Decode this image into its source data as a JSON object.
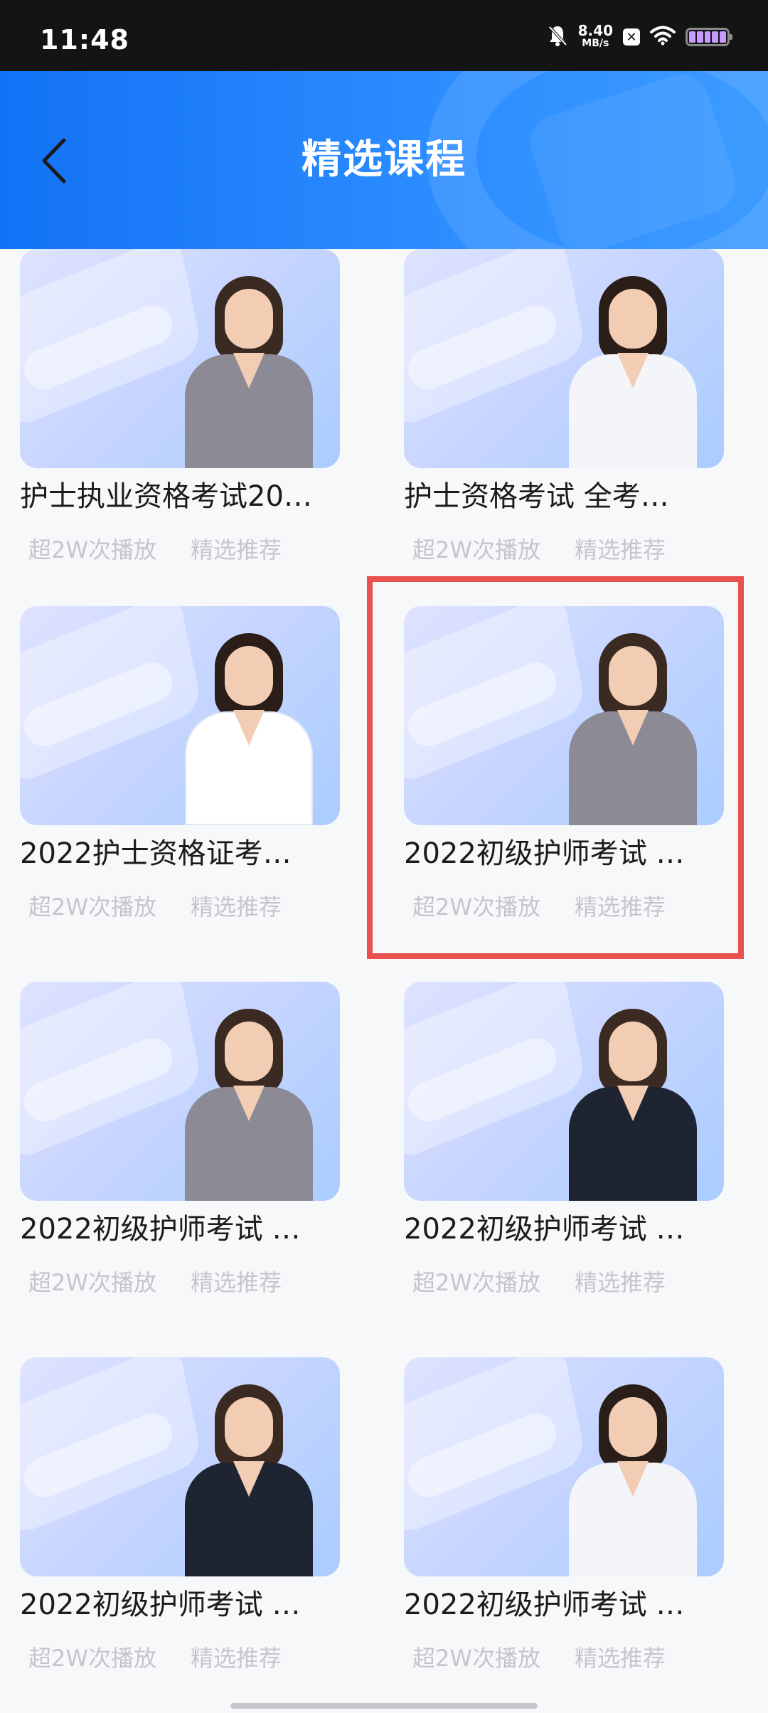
{
  "status_bar": {
    "time": "11:48",
    "net_speed_value": "8.40",
    "net_speed_unit": "MB/s",
    "icons": [
      "bell-muted-icon",
      "x-app-icon",
      "wifi-icon",
      "battery-icon"
    ]
  },
  "header": {
    "title": "精选课程",
    "back_icon": "chevron-left-icon"
  },
  "courses": [
    {
      "title": "护士执业资格考试20…",
      "plays": "超2W次播放",
      "tag": "精选推荐",
      "figure": "woman-gray-blazer-with-book"
    },
    {
      "title": "护士资格考试 全考…",
      "plays": "超2W次播放",
      "tag": "精选推荐",
      "figure": "woman-glasses-white-blouse"
    },
    {
      "title": "2022护士资格证考…",
      "plays": "超2W次播放",
      "tag": "精选推荐",
      "figure": "doctor-white-coat-stethoscope"
    },
    {
      "title": "2022初级护师考试 …",
      "plays": "超2W次播放",
      "tag": "精选推荐",
      "figure": "woman-gray-blazer-with-book",
      "highlighted": true
    },
    {
      "title": "2022初级护师考试 …",
      "plays": "超2W次播放",
      "tag": "精选推荐",
      "figure": "woman-gray-blazer-with-book"
    },
    {
      "title": "2022初级护师考试 …",
      "plays": "超2W次播放",
      "tag": "精选推荐",
      "figure": "woman-dark-suit-with-folder"
    },
    {
      "title": "2022初级护师考试 …",
      "plays": "超2W次播放",
      "tag": "精选推荐",
      "figure": "woman-dark-suit-with-folder"
    },
    {
      "title": "2022初级护师考试 …",
      "plays": "超2W次播放",
      "tag": "精选推荐",
      "figure": "nurse-white-coat-stethoscope"
    }
  ],
  "colors": {
    "header_start": "#1272f5",
    "header_end": "#3d9bff",
    "highlight": "#e8514d",
    "tag_text": "#c4c6cc"
  }
}
